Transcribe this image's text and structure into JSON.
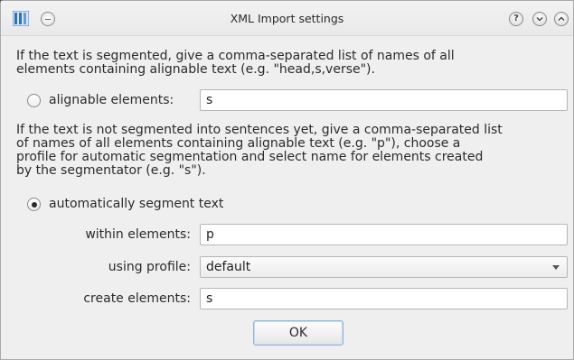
{
  "window": {
    "title": "XML Import settings",
    "help_glyph": "?"
  },
  "description_segmented": "If the text is segmented, give a comma-separated list of names of all\nelements containing alignable text (e.g. \"head,s,verse\").",
  "option_alignable": {
    "label": "alignable elements:",
    "value": "s",
    "checked": false
  },
  "description_unsegmented": "If the text is not segmented into sentences yet, give a comma-separated list\nof names of all elements containing alignable text (e.g. \"p\"), choose a\nprofile for automatic segmentation and select name for elements created\nby the segmentator (e.g. \"s\").",
  "option_auto": {
    "label": "automatically segment text",
    "checked": true
  },
  "within": {
    "label": "within elements:",
    "value": "p"
  },
  "profile": {
    "label": "using profile:",
    "value": "default"
  },
  "create": {
    "label": "create elements:",
    "value": "s"
  },
  "ok_label": "OK",
  "colors": {
    "accent": "#8fb3dc",
    "window_bg": "#efefef"
  }
}
